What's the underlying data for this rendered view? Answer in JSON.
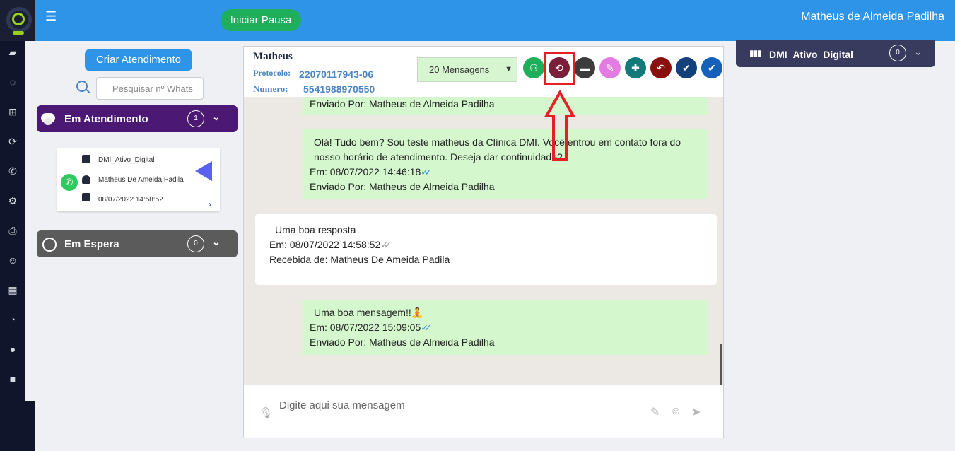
{
  "topbar": {
    "pause_label": "Iniciar Pausa",
    "user_name": "Matheus de Almeida Padilha",
    "menu_icon": "hamburger-icon"
  },
  "sidebar": {
    "icons": [
      "briefcase-icon",
      "whatsapp-icon",
      "plus-square-icon",
      "sync-icon",
      "phone-icon",
      "gear-icon",
      "print-icon",
      "smile-icon",
      "calendar-icon",
      "dashboard-icon",
      "comment-icon",
      "video-icon"
    ]
  },
  "left": {
    "create_label": "Criar Atendimento",
    "search_placeholder": "Pesquisar nº Whats",
    "attending": {
      "title": "Em Atendimento",
      "count": "1"
    },
    "waiting": {
      "title": "Em Espera",
      "count": "0"
    },
    "card": {
      "queue": "DMI_Ativo_Digital",
      "contact": "Matheus De Ameida Padila",
      "date": "08/07/2022 14:58:52"
    }
  },
  "chat": {
    "contact_name": "Matheus",
    "protocol_label": "Protocolo:",
    "protocol_value": "22070117943-06",
    "number_label": "Número:",
    "number_value": "5541988970550",
    "message_count": "20 Mensagens",
    "composer_placeholder": "Digite aqui sua mensagem",
    "messages": [
      {
        "lines": [
          "Enviado Por: Matheus de Almeida Padilha"
        ]
      },
      {
        "text": "Olá! Tudo bem? Sou teste matheus da Clínica DMI. Você entrou em contato fora do nosso horário de atendimento. Deseja dar continuidade?",
        "time": "Em: 08/07/2022 14:46:18",
        "by": "Enviado Por: Matheus de Almeida Padilha"
      },
      {
        "text": "Uma boa resposta",
        "time": "Em: 08/07/2022 14:58:52",
        "by": "Recebida de: Matheus De Ameida Padila"
      },
      {
        "text": "Uma boa mensagem!!",
        "time": "Em: 08/07/2022 15:09:05",
        "by": "Enviado Por: Matheus de Almeida Padilha"
      }
    ]
  },
  "queue": {
    "title": "DMI_Ativo_Digital",
    "count": "0"
  },
  "colors": {
    "primary": "#2d94e8",
    "attending": "#4b1873",
    "waiting": "#5b5b5b",
    "sent_bubble": "#d4f7ce",
    "highlight": "#e61e25"
  }
}
